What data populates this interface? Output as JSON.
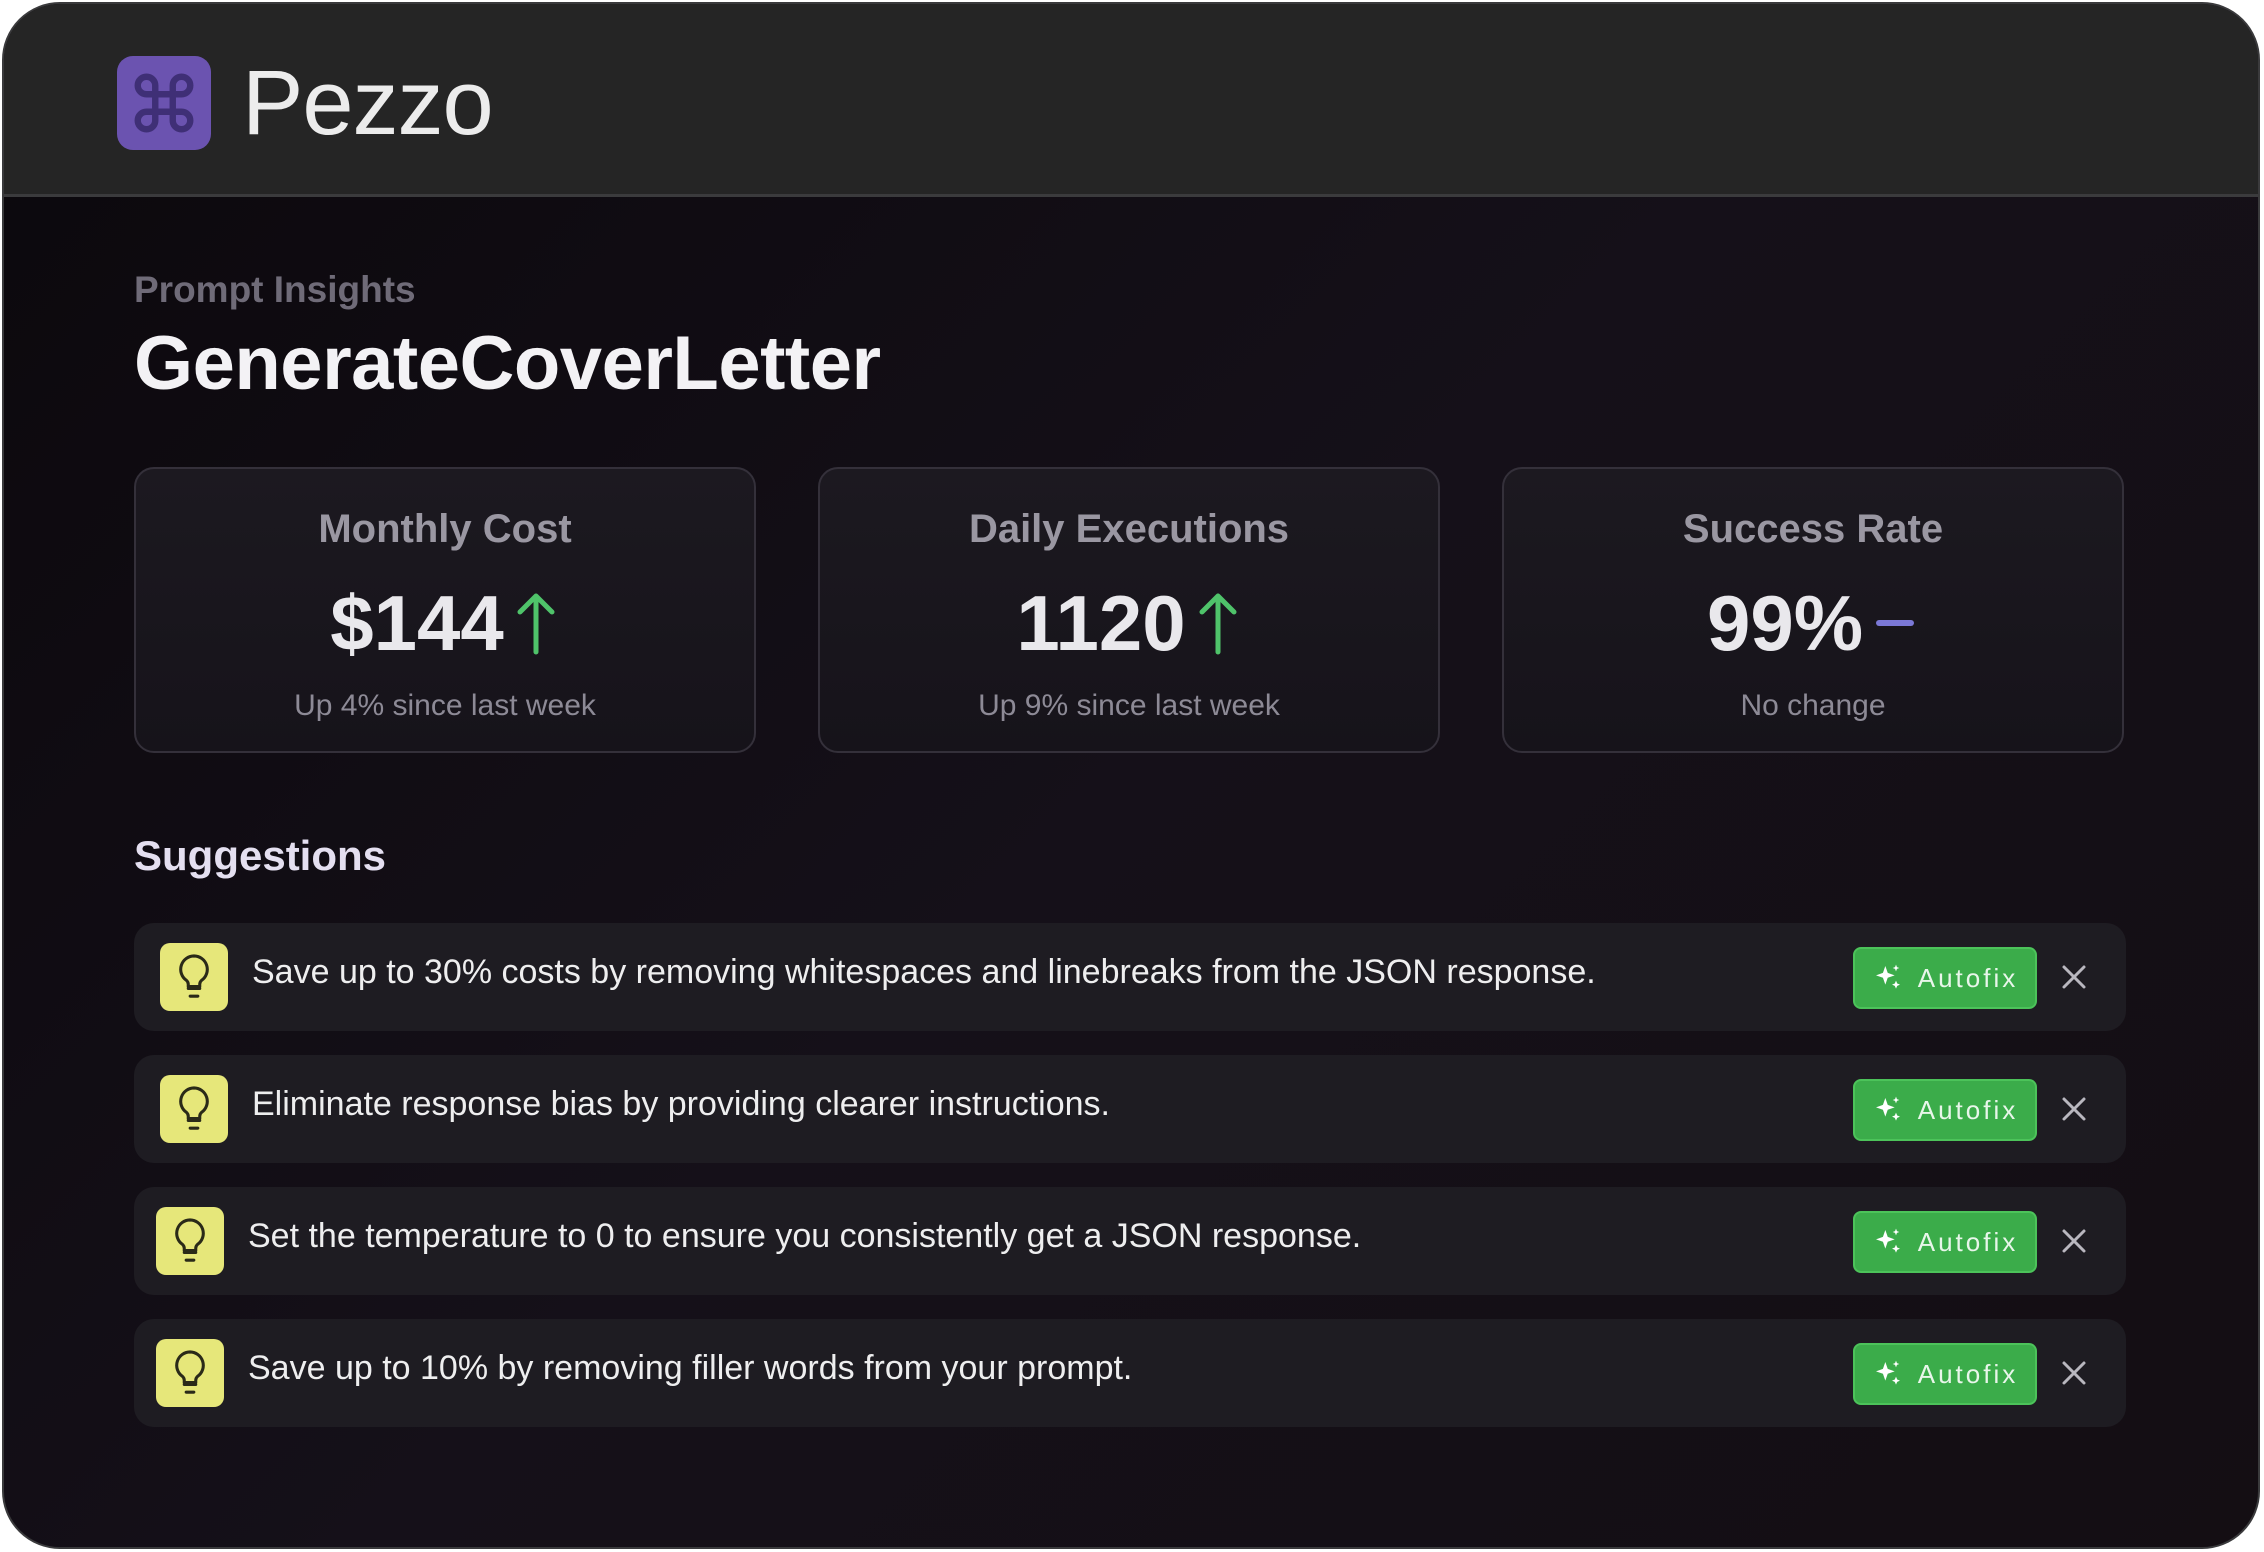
{
  "app": {
    "name": "Pezzo"
  },
  "header": {
    "eyebrow": "Prompt Insights",
    "title": "GenerateCoverLetter"
  },
  "metrics": [
    {
      "label": "Monthly Cost",
      "value": "$144",
      "trend": "up",
      "subtext": "Up 4% since last week"
    },
    {
      "label": "Daily Executions",
      "value": "1120",
      "trend": "up",
      "subtext": "Up 9% since last week"
    },
    {
      "label": "Success Rate",
      "value": "99%",
      "trend": "none",
      "subtext": "No change"
    }
  ],
  "suggestions_section": {
    "title": "Suggestions"
  },
  "suggestions": [
    {
      "text": "Save up to 30% costs by removing whitespaces and linebreaks from the JSON response.",
      "action": "Autofix"
    },
    {
      "text": "Eliminate response bias by providing clearer instructions.",
      "action": "Autofix"
    },
    {
      "text": "Set the temperature to 0 to ensure you consistently get a JSON response.",
      "action": "Autofix"
    },
    {
      "text": "Save up to 10% by removing filler words from your prompt.",
      "action": "Autofix"
    }
  ],
  "colors": {
    "brand": "#6b53b0",
    "trend_up": "#4fc36a",
    "trend_neutral": "#7b78d6",
    "autofix": "#3bac4a",
    "bulb": "#e6e77a"
  },
  "icons": {
    "logo": "command-icon",
    "trend_up": "arrow-up-icon",
    "trend_none": "dash-icon",
    "suggestion": "lightbulb-icon",
    "autofix": "sparkles-icon",
    "dismiss": "close-icon"
  }
}
